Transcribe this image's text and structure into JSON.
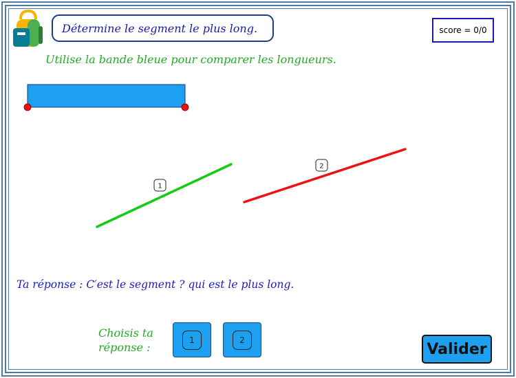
{
  "header": {
    "instruction": "Détermine le segment le plus long.",
    "score_label": "score = 0/0"
  },
  "hint": "Utilise la bande bleue pour comparer les longueurs.",
  "segments": [
    {
      "label": "1",
      "color": "#11cc11"
    },
    {
      "label": "2",
      "color": "#ee1111"
    }
  ],
  "ruler": {
    "color": "#1ea0f0",
    "endpoint_color": "#ee1111"
  },
  "answer": {
    "prefix": "Ta réponse : ",
    "sentence": "C′est le segment ? qui est le plus long."
  },
  "choose_label_line1": "Choisis ta",
  "choose_label_line2": "réponse :",
  "choices": [
    {
      "label": "1"
    },
    {
      "label": "2"
    }
  ],
  "submit_label": "Valider"
}
